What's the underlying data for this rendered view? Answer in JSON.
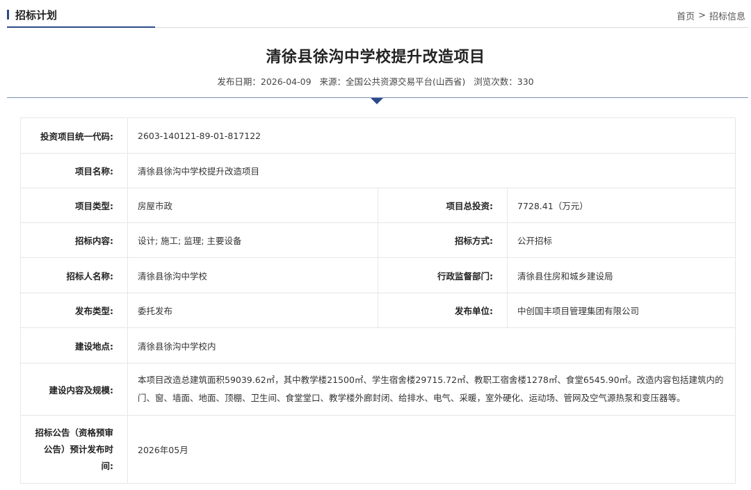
{
  "header": {
    "section_title": "招标计划",
    "breadcrumb": {
      "home": "首页",
      "separator": ">",
      "current": "招标信息"
    },
    "accent_color": "#2b4a8a"
  },
  "article": {
    "title": "清徐县徐沟中学校提升改造项目",
    "meta": {
      "publish_date": "发布日期：2026-04-09",
      "source": "来源：全国公共资源交易平台(山西省)",
      "views": "浏览次数：330"
    }
  },
  "details": {
    "investment_code": {
      "label": "投资项目统一代码:",
      "value": "2603-140121-89-01-817122"
    },
    "project_name": {
      "label": "项目名称:",
      "value": "清徐县徐沟中学校提升改造项目"
    },
    "project_type": {
      "label": "项目类型:",
      "value": "房屋市政"
    },
    "total_investment": {
      "label": "项目总投资:",
      "value": "7728.41（万元）"
    },
    "bid_content": {
      "label": "招标内容:",
      "value": "设计; 施工; 监理; 主要设备"
    },
    "bid_method": {
      "label": "招标方式:",
      "value": "公开招标"
    },
    "tenderer": {
      "label": "招标人名称:",
      "value": "清徐县徐沟中学校"
    },
    "supervisor": {
      "label": "行政监督部门:",
      "value": "清徐县住房和城乡建设局"
    },
    "publish_type": {
      "label": "发布类型:",
      "value": "委托发布"
    },
    "publisher": {
      "label": "发布单位:",
      "value": "中创国丰项目管理集团有限公司"
    },
    "location": {
      "label": "建设地点:",
      "value": "清徐县徐沟中学校内"
    },
    "scope": {
      "label": "建设内容及规模:",
      "value": "本项目改造总建筑面积59039.62㎡，其中教学楼21500㎡、学生宿舍楼29715.72㎡、教职工宿舍楼1278㎡、食堂6545.90㎡。改造内容包括建筑内的门、窗、墙面、地面、顶棚、卫生间、食堂堂口、教学楼外廊封闭、给排水、电气、采暖，室外硬化、运动场、管网及空气源热泵和变压器等。"
    },
    "announce_time": {
      "label_line1": "招标公告（资格预审",
      "label_line2": "公告）预计发布时",
      "label_line3": "间:",
      "value": "2026年05月"
    }
  }
}
